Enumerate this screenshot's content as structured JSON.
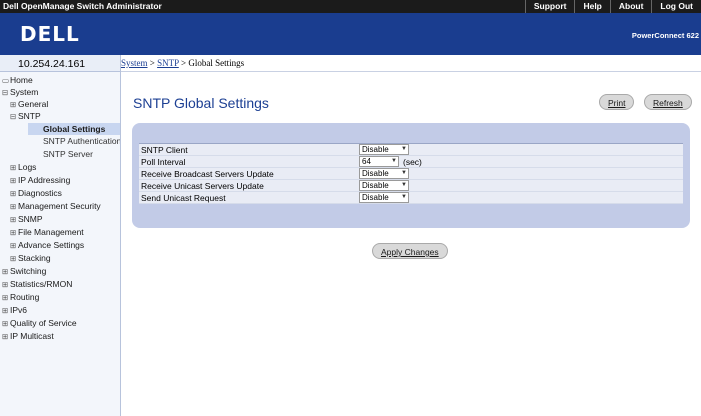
{
  "topbar": {
    "title": "Dell OpenManage Switch Administrator",
    "links": [
      "Support",
      "Help",
      "About",
      "Log Out"
    ]
  },
  "banner": {
    "logo": "DELL",
    "product": "PowerConnect 622"
  },
  "ip_address": "10.254.24.161",
  "breadcrumb": {
    "system": "System",
    "sep1": " > ",
    "sntp": "SNTP",
    "sep2": " > ",
    "current": "Global Settings"
  },
  "nav": {
    "items": [
      {
        "label": "Home",
        "icon": "folder-icon"
      },
      {
        "label": "System",
        "icon": "minus-icon"
      },
      {
        "label": "General",
        "icon": "plus-icon"
      },
      {
        "label": "SNTP",
        "icon": "minus-icon"
      },
      {
        "label": "Global Settings",
        "icon": "none"
      },
      {
        "label": "SNTP Authentication",
        "icon": "none"
      },
      {
        "label": "SNTP Server",
        "icon": "none"
      },
      {
        "label": "Logs",
        "icon": "plus-icon"
      },
      {
        "label": "IP Addressing",
        "icon": "plus-icon"
      },
      {
        "label": "Diagnostics",
        "icon": "plus-icon"
      },
      {
        "label": "Management Security",
        "icon": "plus-icon"
      },
      {
        "label": "SNMP",
        "icon": "plus-icon"
      },
      {
        "label": "File Management",
        "icon": "plus-icon"
      },
      {
        "label": "Advance Settings",
        "icon": "plus-icon"
      },
      {
        "label": "Stacking",
        "icon": "plus-icon"
      },
      {
        "label": "Switching",
        "icon": "plus-icon"
      },
      {
        "label": "Statistics/RMON",
        "icon": "plus-icon"
      },
      {
        "label": "Routing",
        "icon": "plus-icon"
      },
      {
        "label": "IPv6",
        "icon": "plus-icon"
      },
      {
        "label": "Quality of Service",
        "icon": "plus-icon"
      },
      {
        "label": "IP Multicast",
        "icon": "plus-icon"
      }
    ]
  },
  "main": {
    "title": "SNTP Global Settings",
    "print_label": "Print",
    "refresh_label": "Refresh",
    "apply_label": "Apply Changes",
    "rows": [
      {
        "label": "SNTP Client",
        "value": "Disable",
        "unit": ""
      },
      {
        "label": "Poll Interval",
        "value": "64",
        "unit": "(sec)"
      },
      {
        "label": "Receive Broadcast Servers Update",
        "value": "Disable",
        "unit": ""
      },
      {
        "label": "Receive Unicast Servers Update",
        "value": "Disable",
        "unit": ""
      },
      {
        "label": "Send Unicast Request",
        "value": "Disable",
        "unit": ""
      }
    ]
  },
  "colors": {
    "banner": "#1a3d8f",
    "link": "#1c3f93",
    "form_frame": "#c2cbe7",
    "topbar": "#1b1b1b"
  }
}
